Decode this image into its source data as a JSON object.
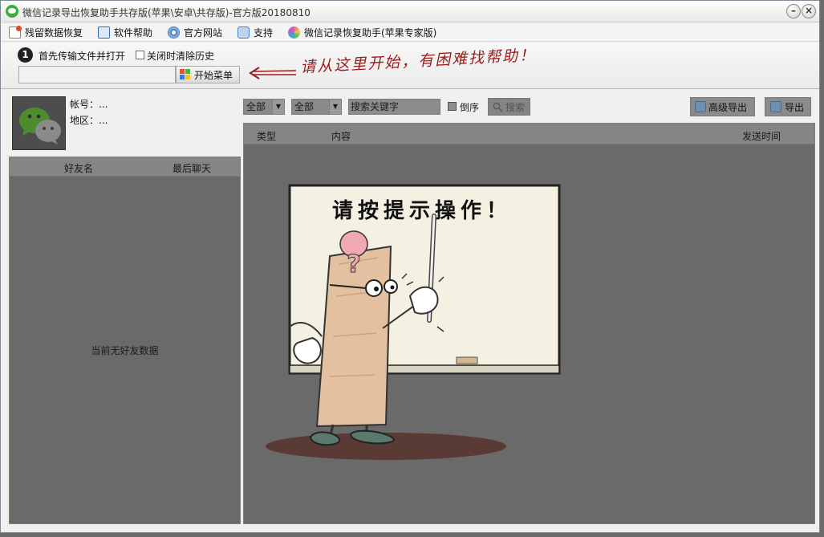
{
  "window": {
    "title": "微信记录导出恢复助手共存版(苹果\\安卓\\共存版)-官方版20180810",
    "minimize_glyph": "–",
    "close_glyph": "×"
  },
  "menu": {
    "items": [
      {
        "label": "残留数据恢复",
        "icon": "document-icon",
        "color": "#d94a2b"
      },
      {
        "label": "软件帮助",
        "icon": "help-icon",
        "color": "#2f6bbf"
      },
      {
        "label": "官方网站",
        "icon": "compass-icon",
        "color": "#3b78c9"
      },
      {
        "label": "支持",
        "icon": "chat-icon",
        "color": "#4a84c8"
      },
      {
        "label": "微信记录恢复助手(苹果专家版)",
        "icon": "color-wheel-icon",
        "color": "#e05fa0"
      }
    ]
  },
  "toolbar": {
    "step_number": "1",
    "step_text": "首先传输文件并打开",
    "clear_history_label": "关闭时清除历史",
    "clear_history_checked": false,
    "path_value": "",
    "start_button_label": "开始菜单",
    "hint_text": "请从这里开始，有困难找帮助！",
    "hint_color": "#9b1b1b"
  },
  "account": {
    "account_label": "帐号：...",
    "region_label": "地区：..."
  },
  "friends": {
    "columns": [
      "好友名",
      "最后聊天"
    ],
    "empty_text": "当前无好友数据"
  },
  "filters": {
    "type_select": "全部",
    "sender_select": "全部",
    "search_placeholder": "搜索关键字",
    "reverse_label": "倒序",
    "reverse_checked": false,
    "search_button_label": "搜索",
    "advanced_export_label": "高级导出",
    "export_label": "导出"
  },
  "messages": {
    "columns": [
      "类型",
      "内容",
      "发送时间"
    ]
  },
  "illustration": {
    "board_text": "请按提示操作！",
    "question_mark": "?"
  }
}
